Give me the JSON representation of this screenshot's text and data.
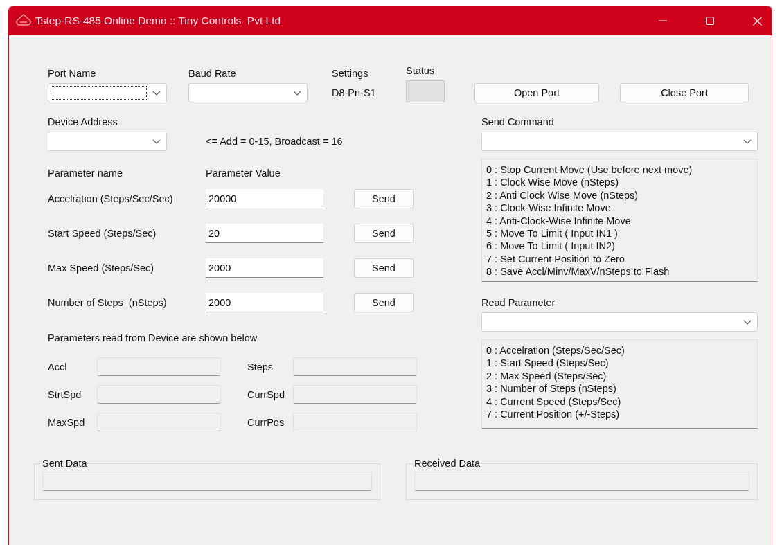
{
  "window": {
    "title": "Tstep-RS-485 Online Demo :: Tiny Controls  Pvt Ltd"
  },
  "connection": {
    "port_name": {
      "label": "Port Name",
      "focused": true
    },
    "baud_rate": {
      "label": "Baud Rate"
    },
    "settings": {
      "label": "Settings",
      "value": "D8-Pn-S1"
    },
    "status": {
      "label": "Status"
    },
    "buttons": [
      "Open Port",
      "Close Port"
    ]
  },
  "device_address": {
    "label": "Device Address",
    "hint": "<= Add = 0-15, Broadcast = 16"
  },
  "parameters": {
    "columns": [
      "Parameter name",
      "Parameter Value"
    ],
    "rows": [
      {
        "name": "Accelration (Steps/Sec/Sec)",
        "value": "20000",
        "button": "Send"
      },
      {
        "name": "Start Speed (Steps/Sec)",
        "value": "20",
        "button": "Send"
      },
      {
        "name": "Max Speed (Steps/Sec)",
        "value": "2000",
        "button": "Send"
      },
      {
        "name": "Number of Steps  (nSteps)",
        "value": "2000",
        "button": "Send"
      }
    ]
  },
  "readback": {
    "heading": "Parameters read from Device are shown below",
    "fields": [
      {
        "label": "Accl"
      },
      {
        "label": "Steps"
      },
      {
        "label": "StrtSpd"
      },
      {
        "label": "CurrSpd"
      },
      {
        "label": "MaxSpd"
      },
      {
        "label": "CurrPos"
      }
    ]
  },
  "send_command": {
    "label": "Send Command",
    "options": [
      "0 : Stop Current Move (Use before next move)",
      "1 : Clock Wise Move (nSteps)",
      "2 : Anti Clock Wise Move (nSteps)",
      "3 : Clock-Wise Infinite Move",
      "4 : Anti-Clock-Wise Infinite Move",
      "5 : Move To Limit ( Input IN1 )",
      "6 : Move To Limit ( Input IN2)",
      "7 : Set Current Position to Zero",
      "8 : Save Accl/Minv/MaxV/nSteps to Flash"
    ]
  },
  "read_parameter": {
    "label": "Read Parameter",
    "options": [
      "0 : Accelration (Steps/Sec/Sec)",
      "1 : Start Speed (Steps/Sec)",
      "2 : Max Speed (Steps/Sec)",
      "3 : Number of Steps (nSteps)",
      "4 : Current Speed (Steps/Sec)",
      "7 : Current Position (+/-Steps)"
    ]
  },
  "sent_data": {
    "label": "Sent Data"
  },
  "received_data": {
    "label": "Received Data"
  }
}
